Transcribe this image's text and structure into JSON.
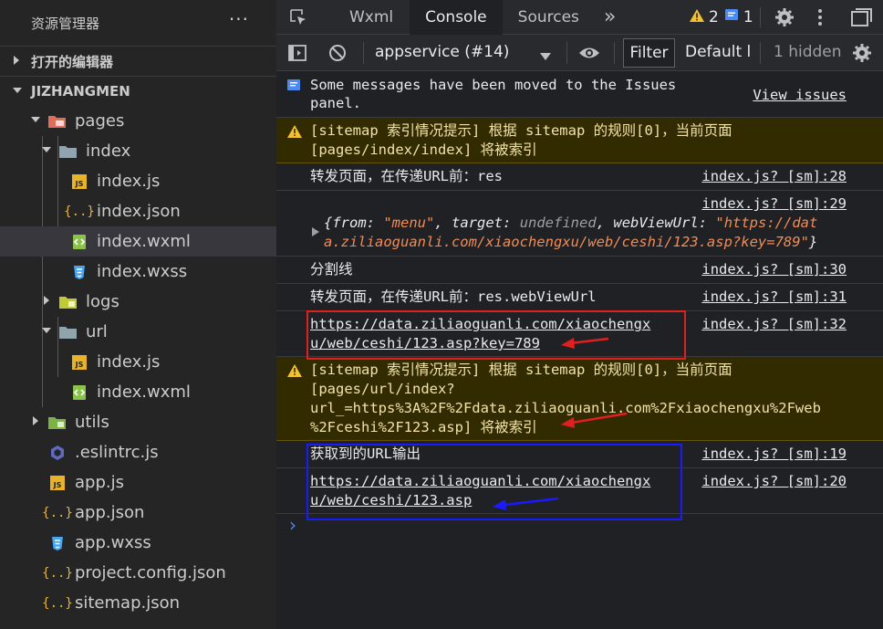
{
  "sidebar": {
    "title": "资源管理器",
    "more": "···",
    "open_editors": "打开的编辑器",
    "project": "JIZHANGMEN",
    "tree": [
      {
        "label": "pages"
      },
      {
        "label": "index"
      },
      {
        "label": "index.js"
      },
      {
        "label": "index.json"
      },
      {
        "label": "index.wxml"
      },
      {
        "label": "index.wxss"
      },
      {
        "label": "logs"
      },
      {
        "label": "url"
      },
      {
        "label": "index.js"
      },
      {
        "label": "index.wxml"
      },
      {
        "label": "utils"
      },
      {
        "label": ".eslintrc.js"
      },
      {
        "label": "app.js"
      },
      {
        "label": "app.json"
      },
      {
        "label": "app.wxss"
      },
      {
        "label": "project.config.json"
      },
      {
        "label": "sitemap.json"
      }
    ]
  },
  "tabs": {
    "wxml": "Wxml",
    "console": "Console",
    "sources": "Sources",
    "more": "»",
    "warn_count": "2",
    "msg_count": "1"
  },
  "toolbar": {
    "context": "appservice (#14)",
    "filter": "Filter",
    "levels": "Default le",
    "hidden": "1 hidden"
  },
  "console": {
    "info_msg_1": "Some messages have been moved to the Issues",
    "info_msg_2": "panel.",
    "info_link": "View issues",
    "warn1_line1": "[sitemap 索引情况提示] 根据 sitemap 的规则[0]，当前页面",
    "warn1_line2": "[pages/index/index] 将被索引",
    "log1_msg": "转发页面，在传递URL前：res",
    "log1_src": "index.js? [sm]:28",
    "log2_src": "index.js? [sm]:29",
    "obj_from_key": "from",
    "obj_from_val": "\"menu\"",
    "obj_target_key": "target",
    "obj_target_val": "undefined",
    "obj_url_key": "webViewUrl",
    "obj_url_val1": "\"https://dat",
    "obj_url_val2": "a.ziliaoguanli.com/xiaochengxu/web/ceshi/123.asp?key=789\"",
    "log3_msg": "分割线",
    "log3_src": "index.js? [sm]:30",
    "log4_msg": "转发页面，在传递URL前：res.webViewUrl",
    "log4_src": "index.js? [sm]:31",
    "log5_line1": "https://data.ziliaoguanli.com/xiaochengx",
    "log5_line2": "u/web/ceshi/123.asp?key=789",
    "log5_src": "index.js? [sm]:32",
    "warn2_line1": "[sitemap 索引情况提示] 根据 sitemap 的规则[0]，当前页面",
    "warn2_line2": "[pages/url/index?",
    "warn2_line3": "url_=https%3A%2F%2Fdata.ziliaoguanli.com%2Fxiaochengxu%2Fweb",
    "warn2_line4": "%2Fceshi%2F123.asp] 将被索引",
    "log6_msg": "获取到的URL输出",
    "log6_src": "index.js? [sm]:19",
    "log7_line1": "https://data.ziliaoguanli.com/xiaochengx",
    "log7_line2": "u/web/ceshi/123.asp",
    "log7_src": "index.js? [sm]:20",
    "prompt": "›"
  },
  "colors": {
    "annotation_red": "#e02020",
    "annotation_blue": "#1a1aff",
    "warning_bg": "#332b00",
    "warning_text": "#f1e3a7"
  }
}
